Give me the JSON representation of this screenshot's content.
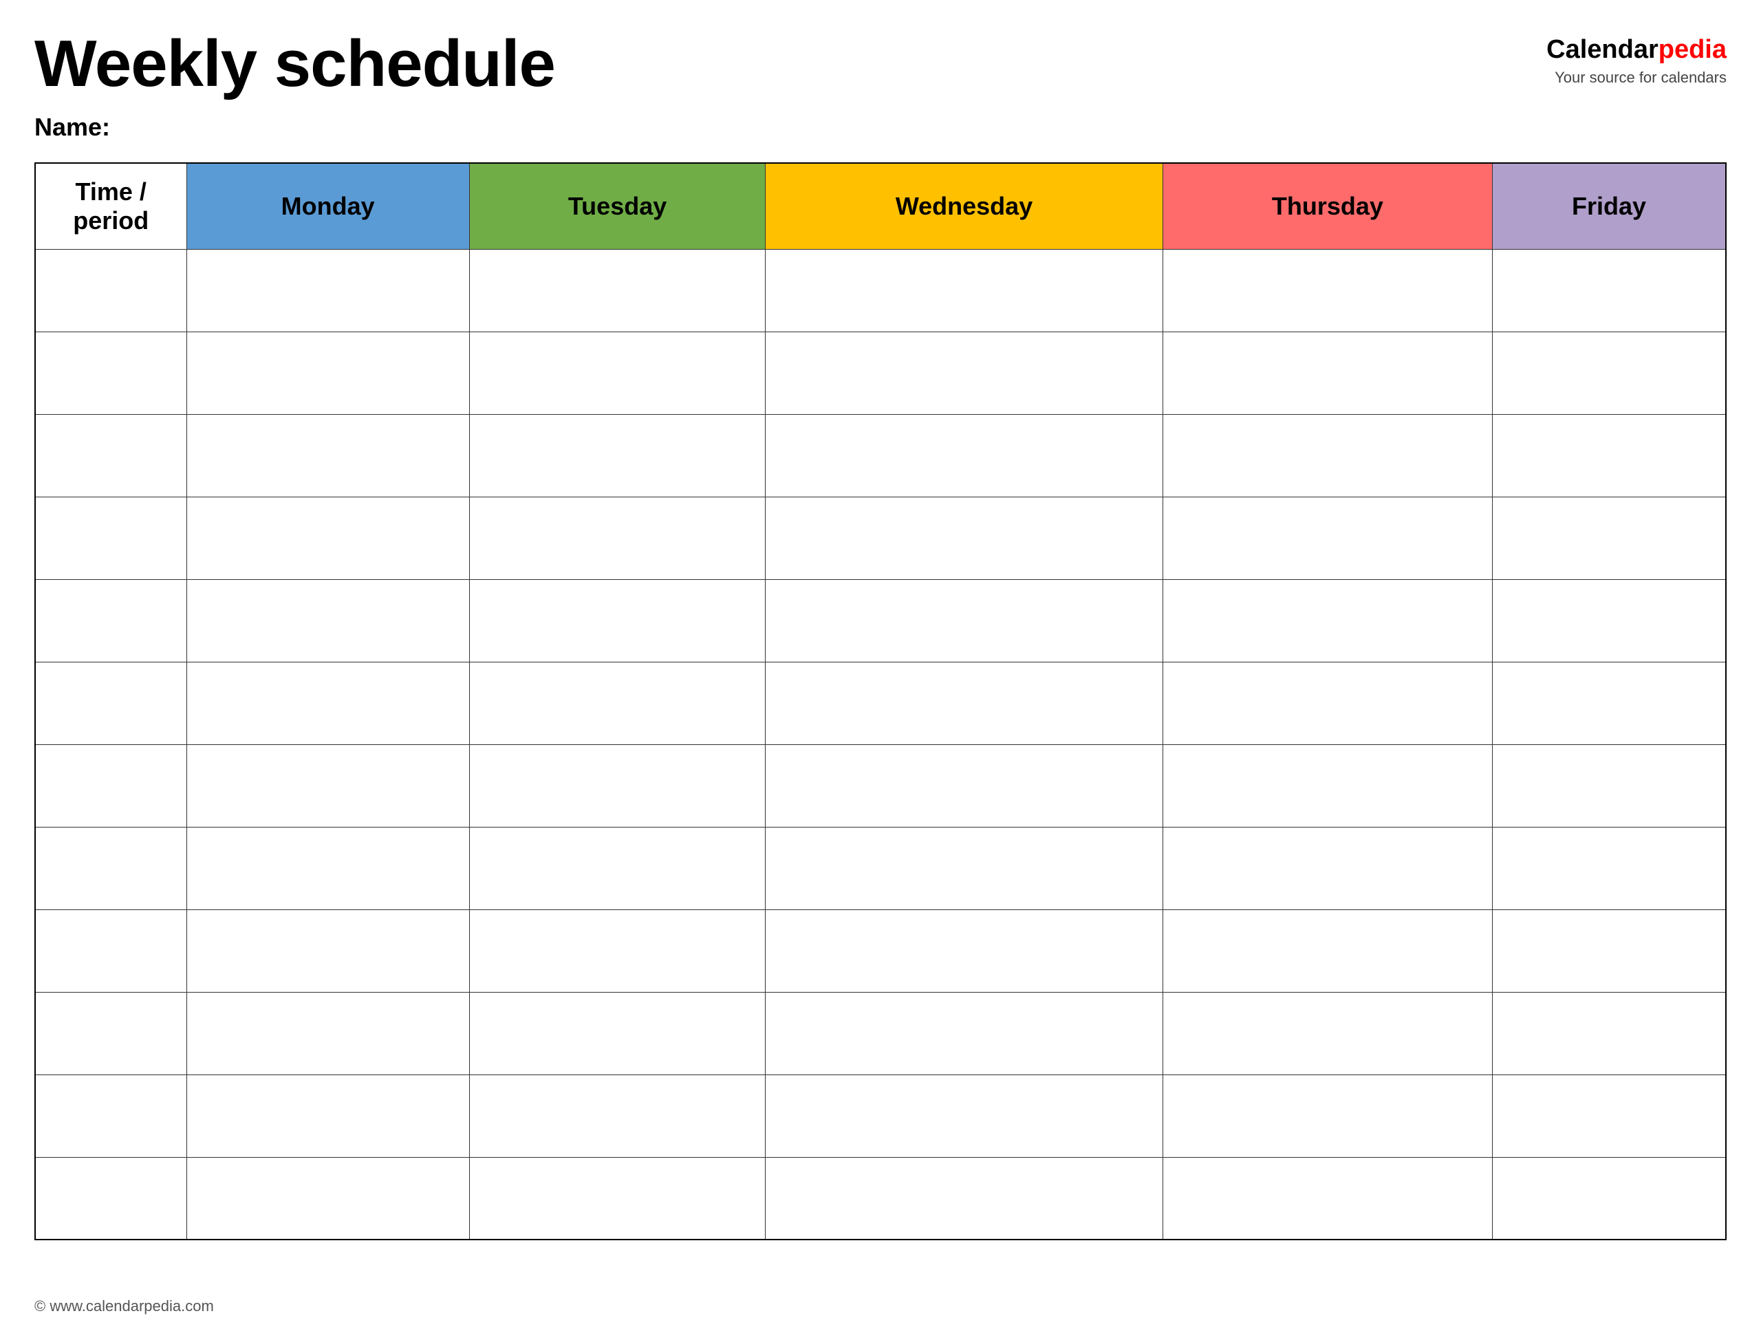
{
  "header": {
    "title": "Weekly schedule",
    "name_label": "Name:",
    "logo_calendar": "Calendar",
    "logo_pedia": "pedia",
    "logo_tagline": "Your source for calendars",
    "footer_url": "© www.calendarpedia.com"
  },
  "table": {
    "columns": [
      {
        "key": "time",
        "label": "Time / period",
        "color_class": "col-time"
      },
      {
        "key": "monday",
        "label": "Monday",
        "color_class": "col-monday"
      },
      {
        "key": "tuesday",
        "label": "Tuesday",
        "color_class": "col-tuesday"
      },
      {
        "key": "wednesday",
        "label": "Wednesday",
        "color_class": "col-wednesday"
      },
      {
        "key": "thursday",
        "label": "Thursday",
        "color_class": "col-thursday"
      },
      {
        "key": "friday",
        "label": "Friday",
        "color_class": "col-friday"
      }
    ],
    "row_count": 12
  }
}
